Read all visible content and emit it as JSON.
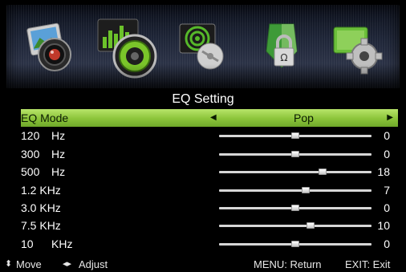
{
  "menu_icons": [
    {
      "name": "picture-icon"
    },
    {
      "name": "sound-icon",
      "selected": true
    },
    {
      "name": "channel-icon"
    },
    {
      "name": "lock-icon"
    },
    {
      "name": "setup-icon"
    }
  ],
  "title": "EQ Setting",
  "eq_mode": {
    "label": "EQ Mode",
    "value": "Pop"
  },
  "bands": [
    {
      "freq": "120",
      "unit": "Hz",
      "value": "0",
      "level": 0
    },
    {
      "freq": "300",
      "unit": "Hz",
      "value": "0",
      "level": 0
    },
    {
      "freq": "500",
      "unit": "Hz",
      "value": "18",
      "level": 18
    },
    {
      "freq": "1.2 KHz",
      "unit": "",
      "value": "7",
      "level": 7
    },
    {
      "freq": "3.0 KHz",
      "unit": "",
      "value": "0",
      "level": 0
    },
    {
      "freq": "7.5 KHz",
      "unit": "",
      "value": "10",
      "level": 10
    },
    {
      "freq": "10",
      "unit": "KHz",
      "value": "0",
      "level": 0
    }
  ],
  "slider_range": [
    -50,
    50
  ],
  "footer": {
    "move": "Move",
    "adjust": "Adjust",
    "menu": "MENU: Return",
    "exit": "EXIT: Exit"
  },
  "colors": {
    "selected_row": "#8bc43a",
    "background": "#000000"
  }
}
